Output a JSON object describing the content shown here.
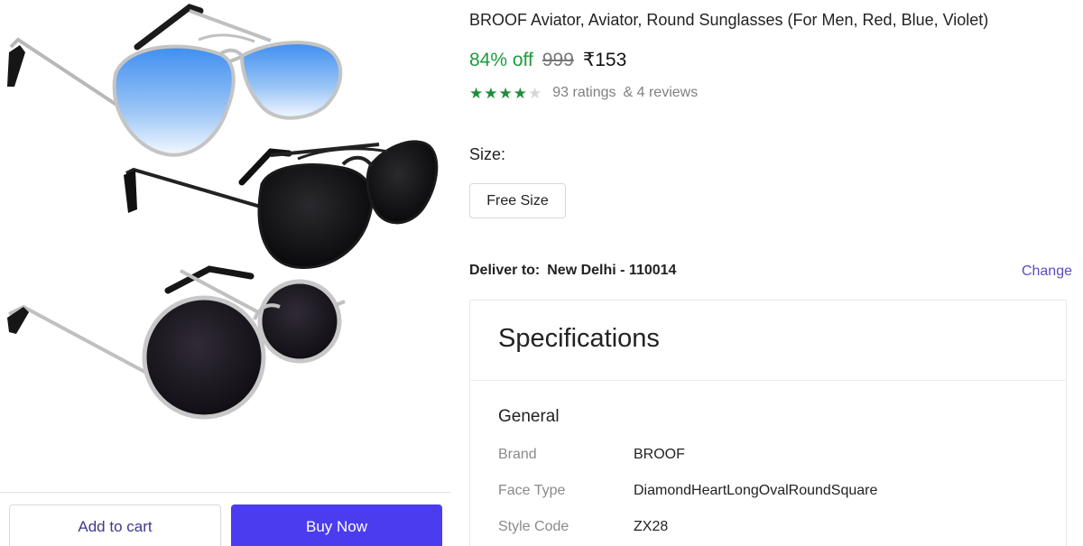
{
  "product": {
    "title": "BROOF Aviator, Aviator, Round Sunglasses (For Men, Red, Blue, Violet)",
    "discount": "84% off",
    "mrp": "999",
    "price": "₹153",
    "rating_stars": 4,
    "rating_max": 5,
    "ratings": "93 ratings",
    "reviews": "& 4 reviews"
  },
  "size": {
    "label": "Size:",
    "option": "Free Size"
  },
  "delivery": {
    "label": "Deliver to:",
    "location": "New Delhi - 110014",
    "change_label": "Change"
  },
  "specifications": {
    "title": "Specifications",
    "section": "General",
    "rows": [
      {
        "key": "Brand",
        "value": "BROOF"
      },
      {
        "key": "Face Type",
        "value": "DiamondHeartLongOvalRoundSquare"
      },
      {
        "key": "Style Code",
        "value": "ZX28"
      }
    ]
  },
  "actions": {
    "add_to_cart": "Add to cart",
    "buy_now": "Buy Now"
  },
  "colors": {
    "discount_green": "#1e9b3c",
    "buy_button": "#4b3cf0",
    "link_purple": "#5b4dbf",
    "star_green": "#1e8d3a"
  },
  "icons": {
    "star": "star-icon"
  }
}
